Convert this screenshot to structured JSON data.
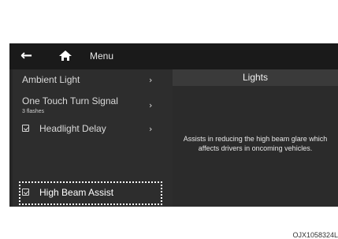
{
  "topbar": {
    "back_icon": "back-arrow-icon",
    "home_icon": "home-icon",
    "menu_label": "Menu"
  },
  "panel": {
    "title": "Lights",
    "description": "Assists in reducing the high beam glare which affects drivers in oncoming vehicles."
  },
  "menu": {
    "items": [
      {
        "label": "Ambient Light",
        "has_submenu": true
      },
      {
        "label": "One Touch Turn Signal",
        "sublabel": "3 flashes",
        "has_submenu": true
      },
      {
        "label": "Headlight Delay",
        "checkbox_checked": true,
        "has_submenu": true
      },
      {
        "label": "High Beam Assist",
        "checkbox_checked": true,
        "selected": true
      }
    ],
    "chevron": "›"
  },
  "colors": {
    "screen_bg": "#262626",
    "topbar_bg": "#1a1a1a",
    "text": "#d9d9d9",
    "focus": "#ffffff"
  },
  "reference_code": "OJX1058324L"
}
